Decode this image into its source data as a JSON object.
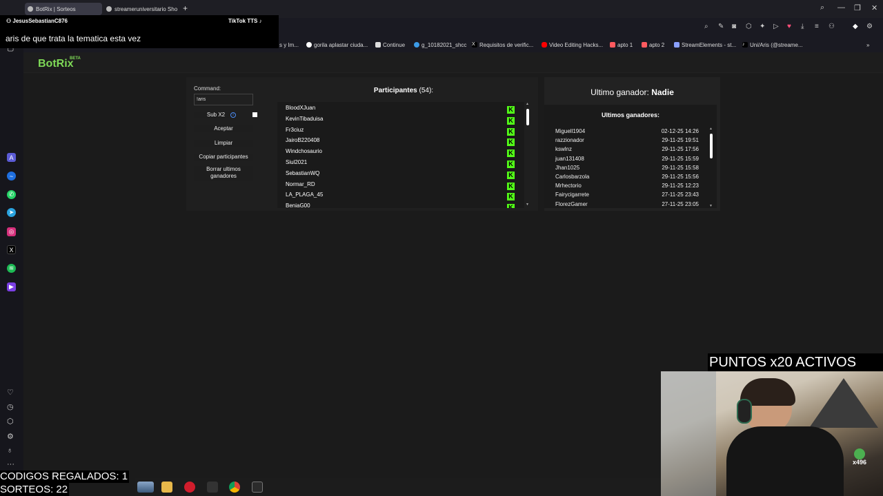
{
  "browser": {
    "tabs": [
      {
        "label": "BotRix | Sorteos"
      },
      {
        "label": "streameruniversitario Sho"
      }
    ],
    "new_tab_label": "+",
    "window_controls": [
      "⌕",
      "—",
      "❐",
      "✕"
    ],
    "bookmarks": [
      {
        "label": "s y Im...",
        "color": "#3f7be6"
      },
      {
        "label": "gorila aplastar ciuda...",
        "color": "#ffffff"
      },
      {
        "label": "Continue",
        "color": "#dddddd"
      },
      {
        "label": "g_10182021_shcc",
        "color": "#3c9be8"
      },
      {
        "label": "Requisitos de verific...",
        "color": "#ffffff"
      },
      {
        "label": "Video Editing Hacks...",
        "color": "#ff0000"
      },
      {
        "label": "apto 1",
        "color": "#ff5a5f"
      },
      {
        "label": "apto 2",
        "color": "#ff5a5f"
      },
      {
        "label": "StreamElements - st...",
        "color": "#8aa0ff"
      },
      {
        "label": "Uni/Aris (@streame...",
        "color": "#ffffff"
      }
    ]
  },
  "chat": {
    "username": "JesusSebastianC876",
    "source": "TikTok TTS",
    "message": "aris de que trata la tematica esta vez"
  },
  "app": {
    "logo": "BotRix",
    "logo_badge": "BETA",
    "command_label": "Command:",
    "command_value": "!aris",
    "sub_label": "Sub X2",
    "sub_checked": true,
    "buttons": {
      "accept": "Aceptar",
      "clear": "Limpiar",
      "copy": "Copiar participantes",
      "delete_line1": "Borrar ultimos",
      "delete_line2": "ganadores"
    },
    "participants_label": "Participantes",
    "participants_count": "(54):",
    "participants": [
      "BloodXJuan",
      "KevinTibaduisa",
      "Fr3ciuz",
      "JairoB220408",
      "Windchosaurio",
      "Siul2021",
      "SebastianWQ",
      "Normar_RD",
      "LA_PLAGA_45",
      "BeniaG00"
    ],
    "platform_icon": "kick-icon",
    "last_winner_label": "Ultimo ganador:",
    "last_winner_value": "Nadie",
    "winners_title": "Ultimos ganadores:",
    "winners": [
      {
        "name": "Miguell1904",
        "date": "02-12-25 14:26"
      },
      {
        "name": "razzionador",
        "date": "29-11-25 19:51"
      },
      {
        "name": "kswlnz",
        "date": "29-11-25 17:56"
      },
      {
        "name": "juan131408",
        "date": "29-11-25 15:59"
      },
      {
        "name": "Jhan1025",
        "date": "29-11-25 15:58"
      },
      {
        "name": "Carlosbarzola",
        "date": "29-11-25 15:56"
      },
      {
        "name": "Mrhectorio",
        "date": "29-11-25 12:23"
      },
      {
        "name": "Fairycigarrete",
        "date": "27-11-25 23:43"
      },
      {
        "name": "FlorezGamer",
        "date": "27-11-25 23:05"
      }
    ]
  },
  "overlay": {
    "puntos": "PUNTOS x20 ACTIVOS",
    "codigos": "CODIGOS REGALADOS: 1",
    "sorteos": "SORTEOS: 22",
    "badge": "x496"
  },
  "colors": {
    "kick": "#53fc18",
    "logo": "#7ed957"
  }
}
